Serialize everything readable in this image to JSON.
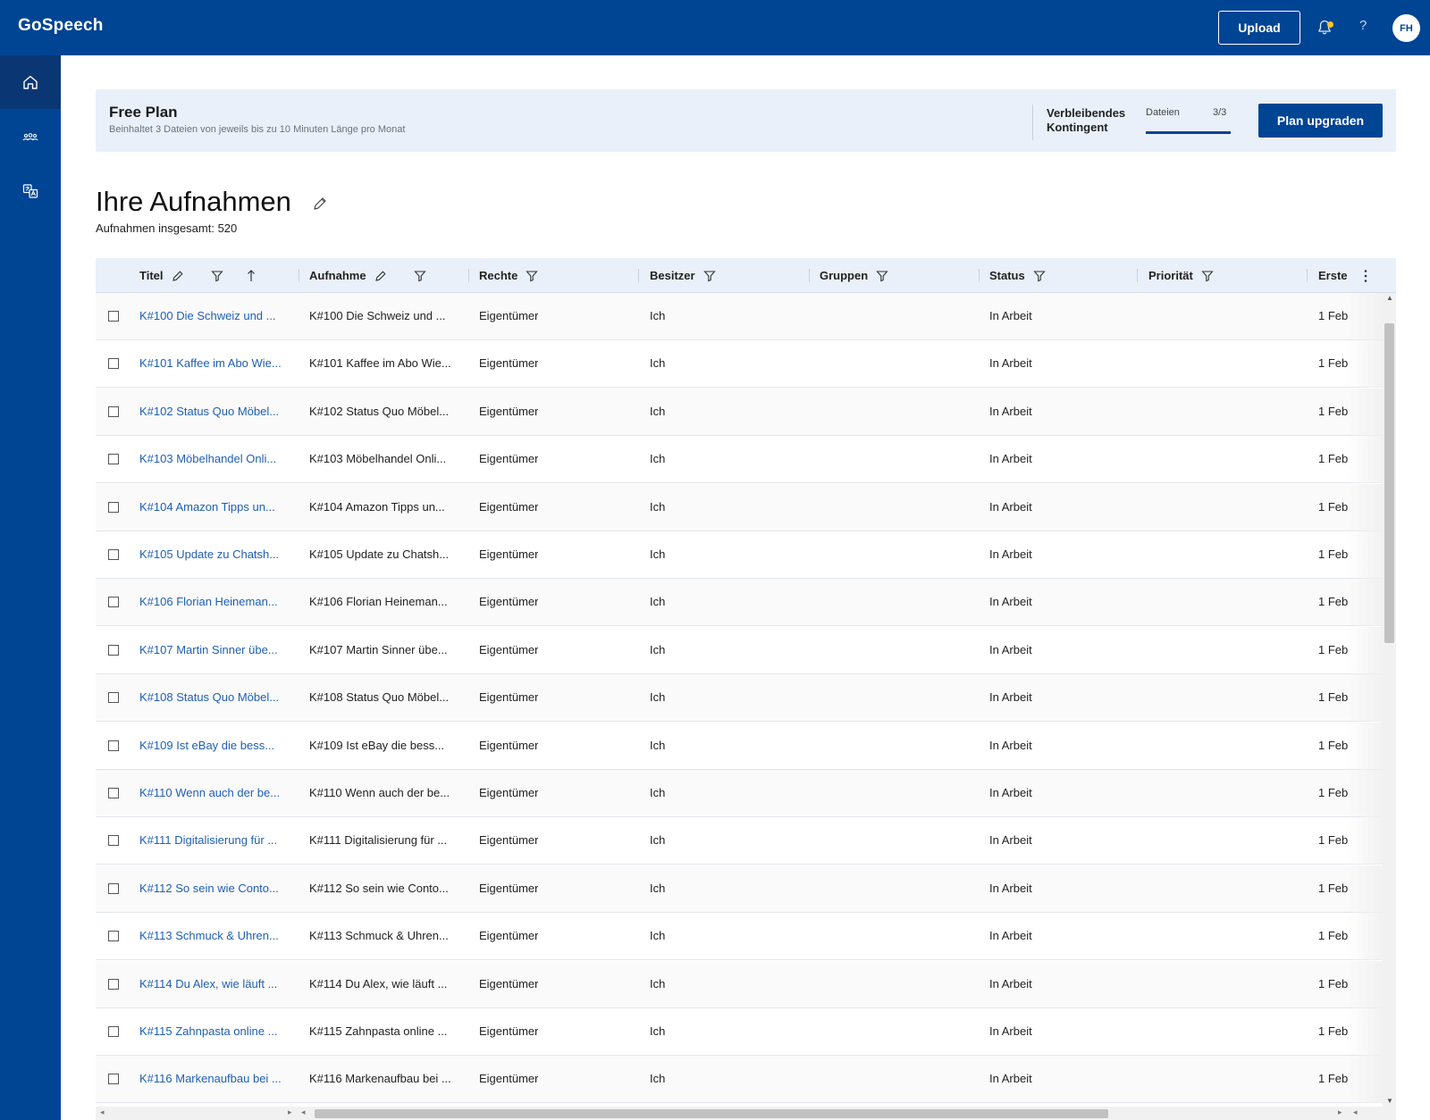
{
  "app": {
    "brand": "GoSpeech",
    "upload_label": "Upload",
    "help_label": "?",
    "avatar_initials": "FH"
  },
  "plan": {
    "title": "Free Plan",
    "description": "Beinhaltet 3 Dateien von jeweils bis zu 10 Minuten Länge pro Monat",
    "quota_label": "Verbleibendes Kontingent",
    "quota_files_label": "Dateien",
    "quota_count": "3/3",
    "quota_used_fraction": 1.0,
    "upgrade_label": "Plan upgraden"
  },
  "page": {
    "title": "Ihre Aufnahmen",
    "total": "Aufnahmen insgesamt: 520"
  },
  "table": {
    "columns": {
      "title": "Titel",
      "recording": "Aufnahme",
      "rights": "Rechte",
      "owner": "Besitzer",
      "groups": "Gruppen",
      "status": "Status",
      "priority": "Priorität",
      "created": "Erste"
    },
    "rows": [
      {
        "title": "K#100 Die Schweiz und ...",
        "recording": "K#100 Die Schweiz und ...",
        "rights": "Eigentümer",
        "owner": "Ich",
        "groups": "",
        "status": "In Arbeit",
        "priority": "",
        "created": "1 Feb"
      },
      {
        "title": "K#101 Kaffee im Abo Wie...",
        "recording": "K#101 Kaffee im Abo Wie...",
        "rights": "Eigentümer",
        "owner": "Ich",
        "groups": "",
        "status": "In Arbeit",
        "priority": "",
        "created": "1 Feb"
      },
      {
        "title": "K#102 Status Quo Möbel...",
        "recording": "K#102 Status Quo Möbel...",
        "rights": "Eigentümer",
        "owner": "Ich",
        "groups": "",
        "status": "In Arbeit",
        "priority": "",
        "created": "1 Feb"
      },
      {
        "title": "K#103 Möbelhandel Onli...",
        "recording": "K#103 Möbelhandel Onli...",
        "rights": "Eigentümer",
        "owner": "Ich",
        "groups": "",
        "status": "In Arbeit",
        "priority": "",
        "created": "1 Feb"
      },
      {
        "title": "K#104 Amazon Tipps un...",
        "recording": "K#104 Amazon Tipps un...",
        "rights": "Eigentümer",
        "owner": "Ich",
        "groups": "",
        "status": "In Arbeit",
        "priority": "",
        "created": "1 Feb"
      },
      {
        "title": "K#105 Update zu Chatsh...",
        "recording": "K#105 Update zu Chatsh...",
        "rights": "Eigentümer",
        "owner": "Ich",
        "groups": "",
        "status": "In Arbeit",
        "priority": "",
        "created": "1 Feb"
      },
      {
        "title": "K#106 Florian Heineman...",
        "recording": "K#106 Florian Heineman...",
        "rights": "Eigentümer",
        "owner": "Ich",
        "groups": "",
        "status": "In Arbeit",
        "priority": "",
        "created": "1 Feb"
      },
      {
        "title": "K#107 Martin Sinner übe...",
        "recording": "K#107 Martin Sinner übe...",
        "rights": "Eigentümer",
        "owner": "Ich",
        "groups": "",
        "status": "In Arbeit",
        "priority": "",
        "created": "1 Feb"
      },
      {
        "title": "K#108 Status Quo Möbel...",
        "recording": "K#108 Status Quo Möbel...",
        "rights": "Eigentümer",
        "owner": "Ich",
        "groups": "",
        "status": "In Arbeit",
        "priority": "",
        "created": "1 Feb"
      },
      {
        "title": "K#109 Ist eBay die bess...",
        "recording": "K#109 Ist eBay die bess...",
        "rights": "Eigentümer",
        "owner": "Ich",
        "groups": "",
        "status": "In Arbeit",
        "priority": "",
        "created": "1 Feb"
      },
      {
        "title": "K#110 Wenn auch der be...",
        "recording": "K#110 Wenn auch der be...",
        "rights": "Eigentümer",
        "owner": "Ich",
        "groups": "",
        "status": "In Arbeit",
        "priority": "",
        "created": "1 Feb"
      },
      {
        "title": "K#111 Digitalisierung für ...",
        "recording": "K#111 Digitalisierung für ...",
        "rights": "Eigentümer",
        "owner": "Ich",
        "groups": "",
        "status": "In Arbeit",
        "priority": "",
        "created": "1 Feb"
      },
      {
        "title": "K#112 So sein wie Conto...",
        "recording": "K#112 So sein wie Conto...",
        "rights": "Eigentümer",
        "owner": "Ich",
        "groups": "",
        "status": "In Arbeit",
        "priority": "",
        "created": "1 Feb"
      },
      {
        "title": "K#113 Schmuck & Uhren...",
        "recording": "K#113 Schmuck & Uhren...",
        "rights": "Eigentümer",
        "owner": "Ich",
        "groups": "",
        "status": "In Arbeit",
        "priority": "",
        "created": "1 Feb"
      },
      {
        "title": "K#114 Du Alex, wie läuft ...",
        "recording": "K#114 Du Alex, wie läuft ...",
        "rights": "Eigentümer",
        "owner": "Ich",
        "groups": "",
        "status": "In Arbeit",
        "priority": "",
        "created": "1 Feb"
      },
      {
        "title": "K#115 Zahnpasta online ...",
        "recording": "K#115 Zahnpasta online ...",
        "rights": "Eigentümer",
        "owner": "Ich",
        "groups": "",
        "status": "In Arbeit",
        "priority": "",
        "created": "1 Feb"
      },
      {
        "title": "K#116 Markenaufbau bei ...",
        "recording": "K#116 Markenaufbau bei ...",
        "rights": "Eigentümer",
        "owner": "Ich",
        "groups": "",
        "status": "In Arbeit",
        "priority": "",
        "created": "1 Feb"
      }
    ]
  },
  "colors": {
    "primary": "#004494",
    "link": "#1f5fb5",
    "banner_bg": "#e9f0fa",
    "notification_dot": "#f7c531"
  },
  "icons": {
    "sidebar": [
      "home-icon",
      "group-icon",
      "translate-icon"
    ],
    "header": [
      "bell-icon",
      "help-icon"
    ],
    "table": [
      "edit-icon",
      "filter-icon",
      "sort-ascending-icon",
      "more-vertical-icon"
    ]
  }
}
